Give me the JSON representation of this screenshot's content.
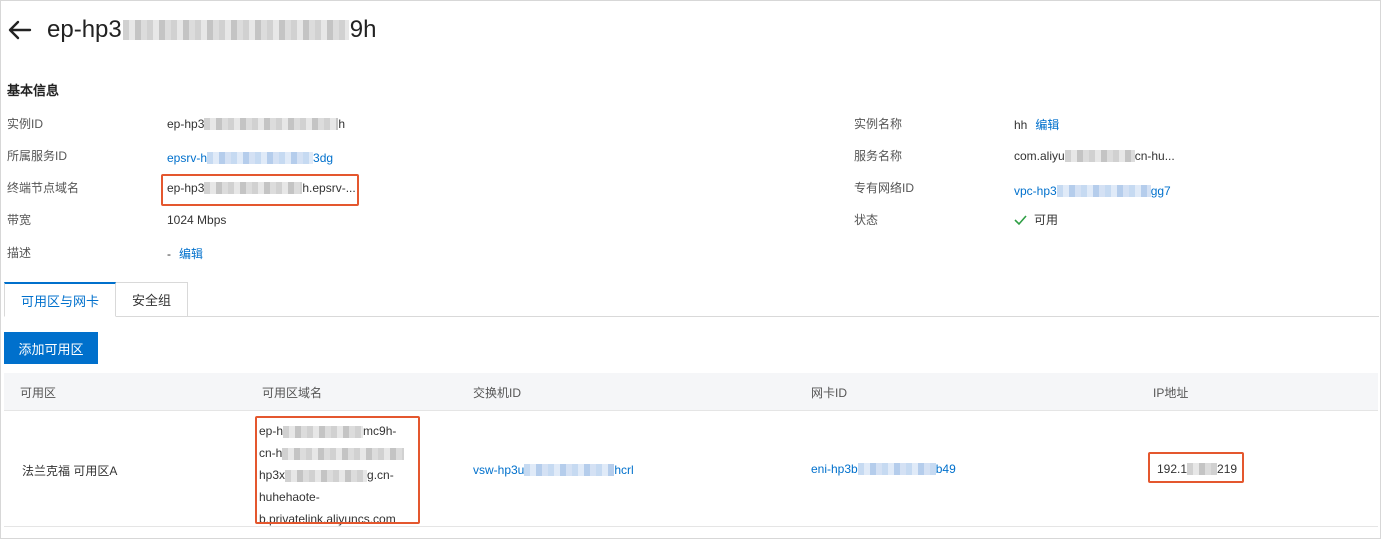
{
  "header": {
    "title_prefix": "ep-hp3",
    "title_suffix": "9h"
  },
  "basic_info": {
    "section_title": "基本信息",
    "left": [
      {
        "label": "实例ID",
        "value_prefix": "ep-hp3",
        "value_suffix": "h"
      },
      {
        "label": "所属服务ID",
        "value_prefix": "epsrv-h",
        "value_suffix": "3dg"
      },
      {
        "label": "终端节点域名",
        "value_prefix": "ep-hp3",
        "value_suffix": "h.epsrv-..."
      },
      {
        "label": "带宽",
        "value": "1024 Mbps"
      },
      {
        "label": "描述",
        "value": "-",
        "edit": "编辑"
      }
    ],
    "right": [
      {
        "label": "实例名称",
        "value": "hh",
        "edit": "编辑"
      },
      {
        "label": "服务名称",
        "value_prefix": "com.aliyu",
        "value_suffix": "cn-hu..."
      },
      {
        "label": "专有网络ID",
        "value_prefix": "vpc-hp3",
        "value_suffix": "gg7"
      },
      {
        "label": "状态",
        "value": "可用"
      }
    ]
  },
  "tabs": [
    {
      "label": "可用区与网卡",
      "active": true
    },
    {
      "label": "安全组",
      "active": false
    }
  ],
  "add_button": "添加可用区",
  "table": {
    "columns": [
      "可用区",
      "可用区域名",
      "交换机ID",
      "网卡ID",
      "IP地址"
    ],
    "row": {
      "zone": "法兰克福 可用区A",
      "domain_lines": [
        {
          "prefix": "ep-h",
          "suffix": "mc9h-"
        },
        {
          "prefix": "cn-h",
          "suffix": ""
        },
        {
          "prefix": "hp3x",
          "suffix": "g.cn-"
        },
        {
          "prefix": "huhehaote-",
          "suffix": ""
        },
        {
          "prefix": "b.privatelink.aliyuncs.com",
          "suffix": ""
        }
      ],
      "vswitch_prefix": "vsw-hp3u",
      "vswitch_suffix": "hcrl",
      "eni_prefix": "eni-hp3b",
      "eni_suffix": "b49",
      "ip_prefix": "192.1",
      "ip_suffix": "219"
    }
  },
  "colors": {
    "link": "#0070cc",
    "highlight": "#e4572e",
    "status_ok": "#2e9e44"
  }
}
